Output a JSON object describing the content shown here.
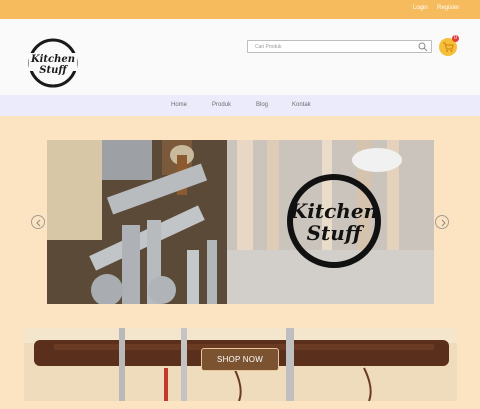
{
  "topbar": {
    "login": "Login",
    "register": "Register"
  },
  "header": {
    "logo_text_top": "Kitchen",
    "logo_text_bottom": "Stuff",
    "search_placeholder": "Cari Produk",
    "cart_count": "0"
  },
  "nav": {
    "items": [
      "Home",
      "Produk",
      "Blog",
      "Kontak"
    ]
  },
  "slider": {
    "logo_text_top": "Kitchen",
    "logo_text_bottom": "Stuff"
  },
  "banner": {
    "button_label": "SHOP NOW"
  },
  "colors": {
    "topbar": "#f6bb5c",
    "header": "#fafafa",
    "nav": "#ebebfb",
    "page": "#fce4c3",
    "cart": "#f4c038",
    "badge": "#e23b3b",
    "button": "#7c5330"
  },
  "icons": [
    "search-icon",
    "cart-icon",
    "chevron-left-icon",
    "chevron-right-icon"
  ]
}
